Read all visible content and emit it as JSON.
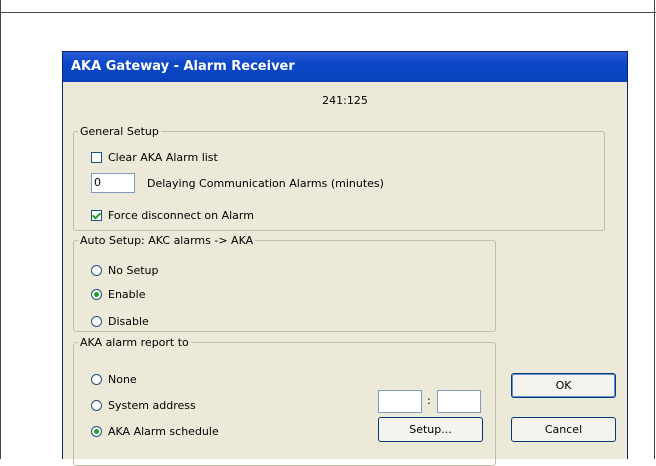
{
  "dialog": {
    "title": "AKA  Gateway - Alarm Receiver",
    "address": "241:125"
  },
  "general_setup": {
    "legend": "General Setup",
    "clear_alarm_list": {
      "label": "Clear AKA Alarm list",
      "checked": false
    },
    "delay": {
      "value": "0",
      "label": "Delaying Communication Alarms (minutes)"
    },
    "force_disconnect": {
      "label": "Force disconnect on Alarm",
      "checked": true
    }
  },
  "auto_setup": {
    "legend": "Auto Setup: AKC alarms -> AKA",
    "options": [
      {
        "label": "No Setup",
        "selected": false
      },
      {
        "label": "Enable",
        "selected": true
      },
      {
        "label": "Disable",
        "selected": false
      }
    ]
  },
  "report_to": {
    "legend": "AKA alarm report to",
    "options": [
      {
        "label": "None",
        "selected": false
      },
      {
        "label": "System address",
        "selected": false
      },
      {
        "label": "AKA Alarm schedule",
        "selected": true
      }
    ],
    "address_part1": "",
    "address_separator": ":",
    "address_part2": "",
    "setup_button": "Setup..."
  },
  "buttons": {
    "ok": "OK",
    "cancel": "Cancel"
  }
}
